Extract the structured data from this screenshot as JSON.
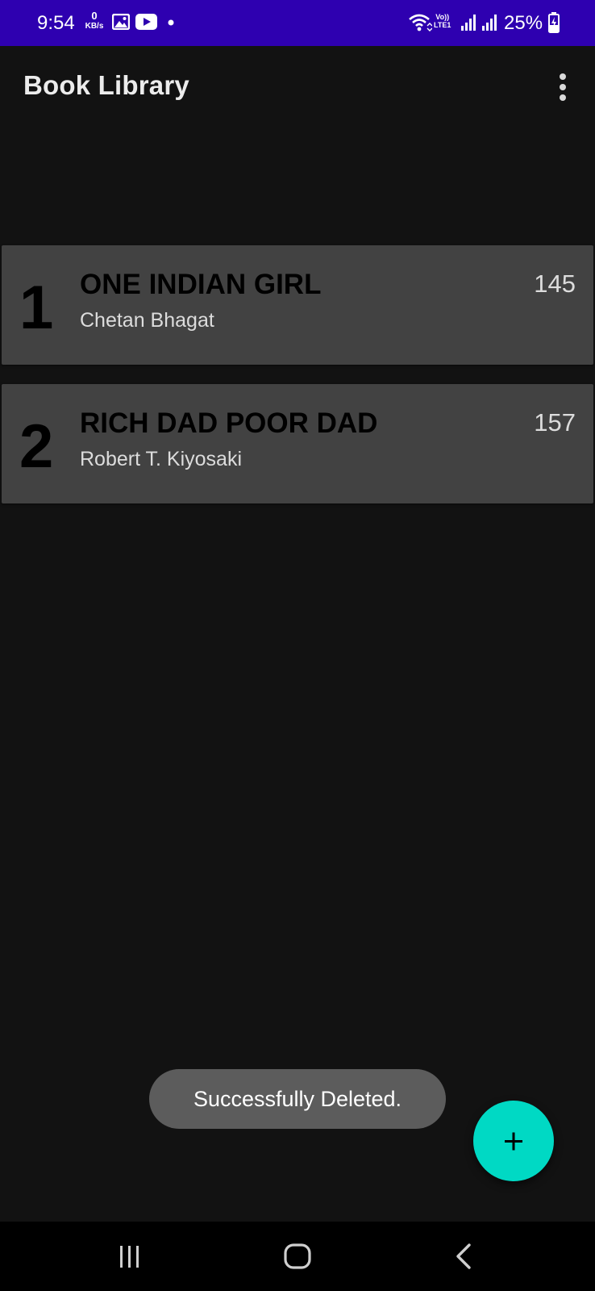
{
  "status_bar": {
    "time": "9:54",
    "data_speed_value": "0",
    "data_speed_unit": "KB/s",
    "volte_line1": "Vo))",
    "volte_line2": "LTE1",
    "battery": "25%",
    "icons": [
      "image-icon",
      "youtube-icon",
      "dot-icon",
      "wifi-icon",
      "signal-icon",
      "signal-icon",
      "battery-charging-icon"
    ],
    "background": "#2e00b0"
  },
  "app_bar": {
    "title": "Book Library",
    "menu_icon": "more-vert-icon"
  },
  "books": [
    {
      "number": "1",
      "title": "ONE INDIAN GIRL",
      "author": "Chetan Bhagat",
      "pages": "145"
    },
    {
      "number": "2",
      "title": "RICH DAD POOR DAD",
      "author": "Robert T. Kiyosaki",
      "pages": "157"
    }
  ],
  "toast": {
    "message": "Successfully Deleted."
  },
  "fab": {
    "icon": "add-icon",
    "color": "#00d9c4"
  },
  "nav_bar": {
    "buttons": [
      "recent-apps-icon",
      "home-icon",
      "back-icon"
    ]
  },
  "colors": {
    "background": "#121212",
    "card": "#424242",
    "accent": "#00d9c4"
  }
}
